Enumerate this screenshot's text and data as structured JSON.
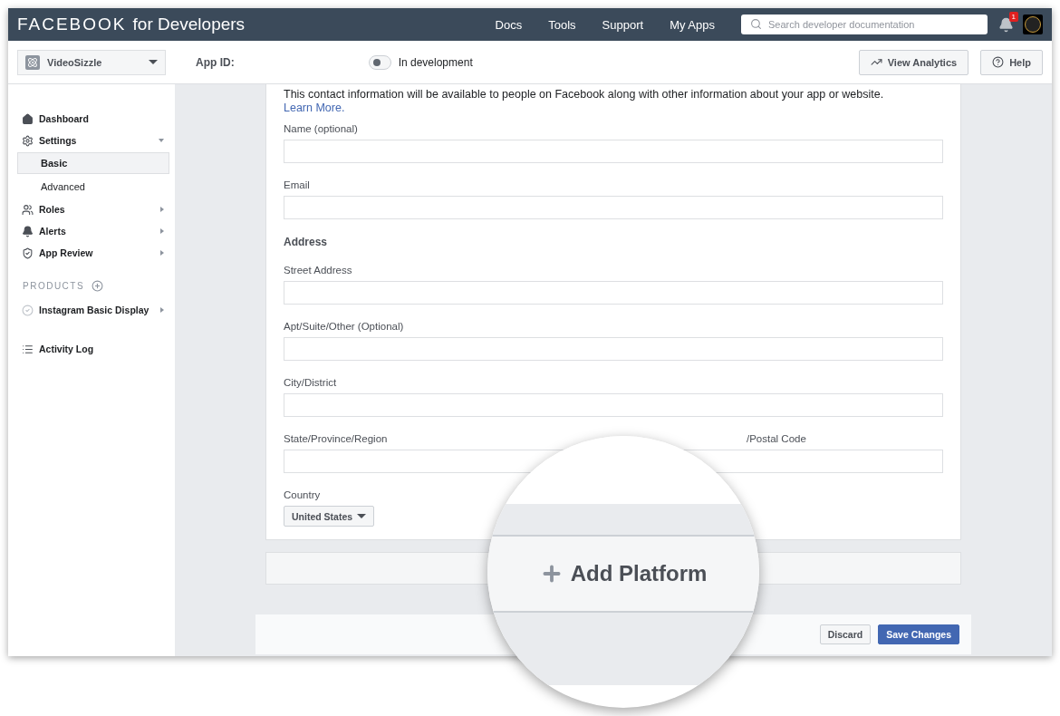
{
  "topbar": {
    "brand": "FACEBOOK",
    "brand_suffix": "for Developers",
    "nav": [
      "Docs",
      "Tools",
      "Support",
      "My Apps"
    ],
    "search": {
      "placeholder": "Search developer documentation"
    },
    "notifications": "1"
  },
  "subheader": {
    "app_name": "VideoSizzle",
    "app_id_label": "App ID:",
    "dev_toggle": {
      "on": false,
      "label": "In development"
    },
    "buttons": [
      {
        "kind": "analytics",
        "label": "View Analytics"
      },
      {
        "kind": "help",
        "label": "Help"
      }
    ]
  },
  "sidebar": {
    "items": [
      {
        "kind": "dashboard",
        "label": "Dashboard"
      },
      {
        "kind": "settings",
        "label": "Settings",
        "expanded": true,
        "children": [
          {
            "label": "Basic",
            "selected": true
          },
          {
            "label": "Advanced",
            "selected": false
          }
        ]
      },
      {
        "kind": "roles",
        "label": "Roles",
        "expanded": false
      },
      {
        "kind": "alerts",
        "label": "Alerts",
        "expanded": false
      },
      {
        "kind": "review",
        "label": "App Review",
        "expanded": false
      }
    ],
    "products_heading": "PRODUCTS",
    "products": [
      {
        "label": "Instagram Basic Display",
        "expanded": false
      }
    ],
    "activity_log": "Activity Log"
  },
  "form": {
    "intro": "This contact information will be available to people on Facebook along with other information about your app or website.",
    "learn_more": "Learn More.",
    "fields_top": [
      {
        "label": "Name (optional)"
      },
      {
        "label": "Email"
      }
    ],
    "address_heading": "Address",
    "fields_address": [
      {
        "label": "Street Address"
      },
      {
        "label": "Apt/Suite/Other (Optional)"
      },
      {
        "label": "City/District"
      }
    ],
    "state_label": "State/Province/Region",
    "zip_label": "/Postal Code",
    "country_label": "Country",
    "country_value": "United States"
  },
  "add_platform": "Add Platform",
  "footer": {
    "discard": "Discard",
    "save": "Save Changes"
  }
}
